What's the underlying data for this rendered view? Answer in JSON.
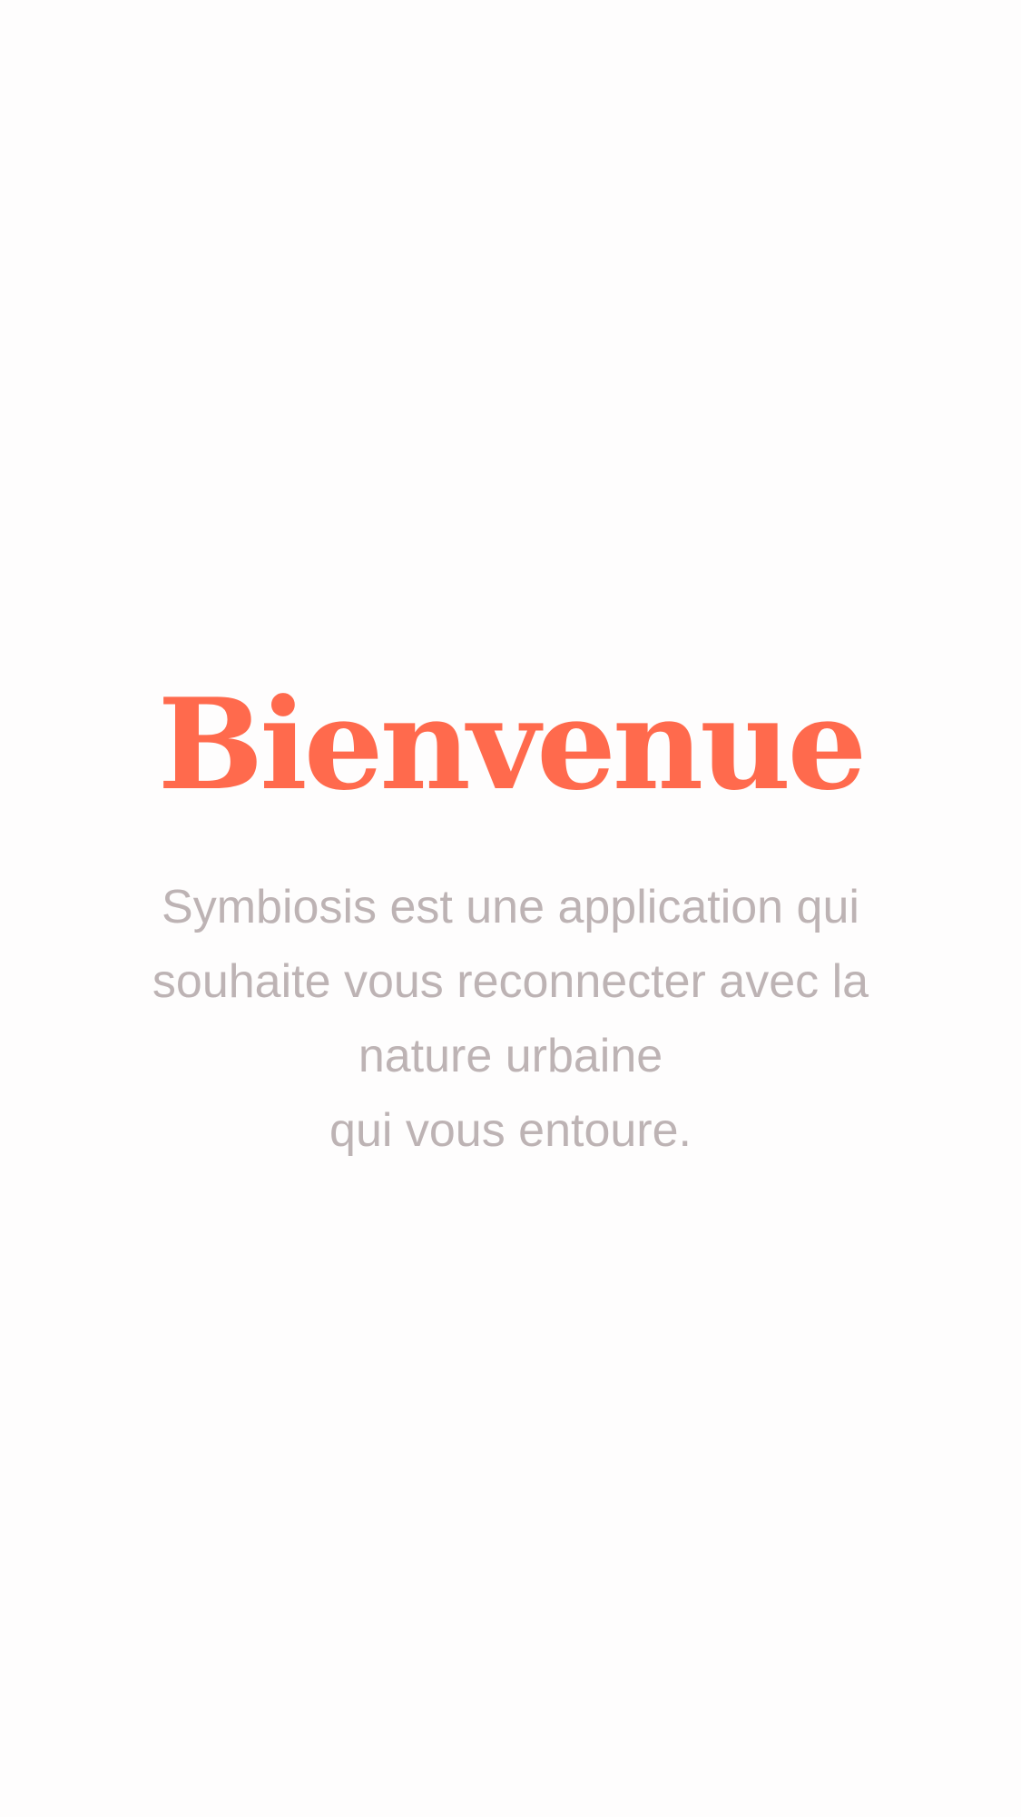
{
  "welcome": {
    "title": "Bienvenue",
    "lines": [
      "Symbiosis est une application qui",
      "souhaite vous reconnecter avec la",
      "nature urbaine",
      "qui vous entoure."
    ]
  },
  "colors": {
    "background": "#FEFDFD",
    "title": "#FF6A4D",
    "body_text": "#BDB3B4"
  }
}
